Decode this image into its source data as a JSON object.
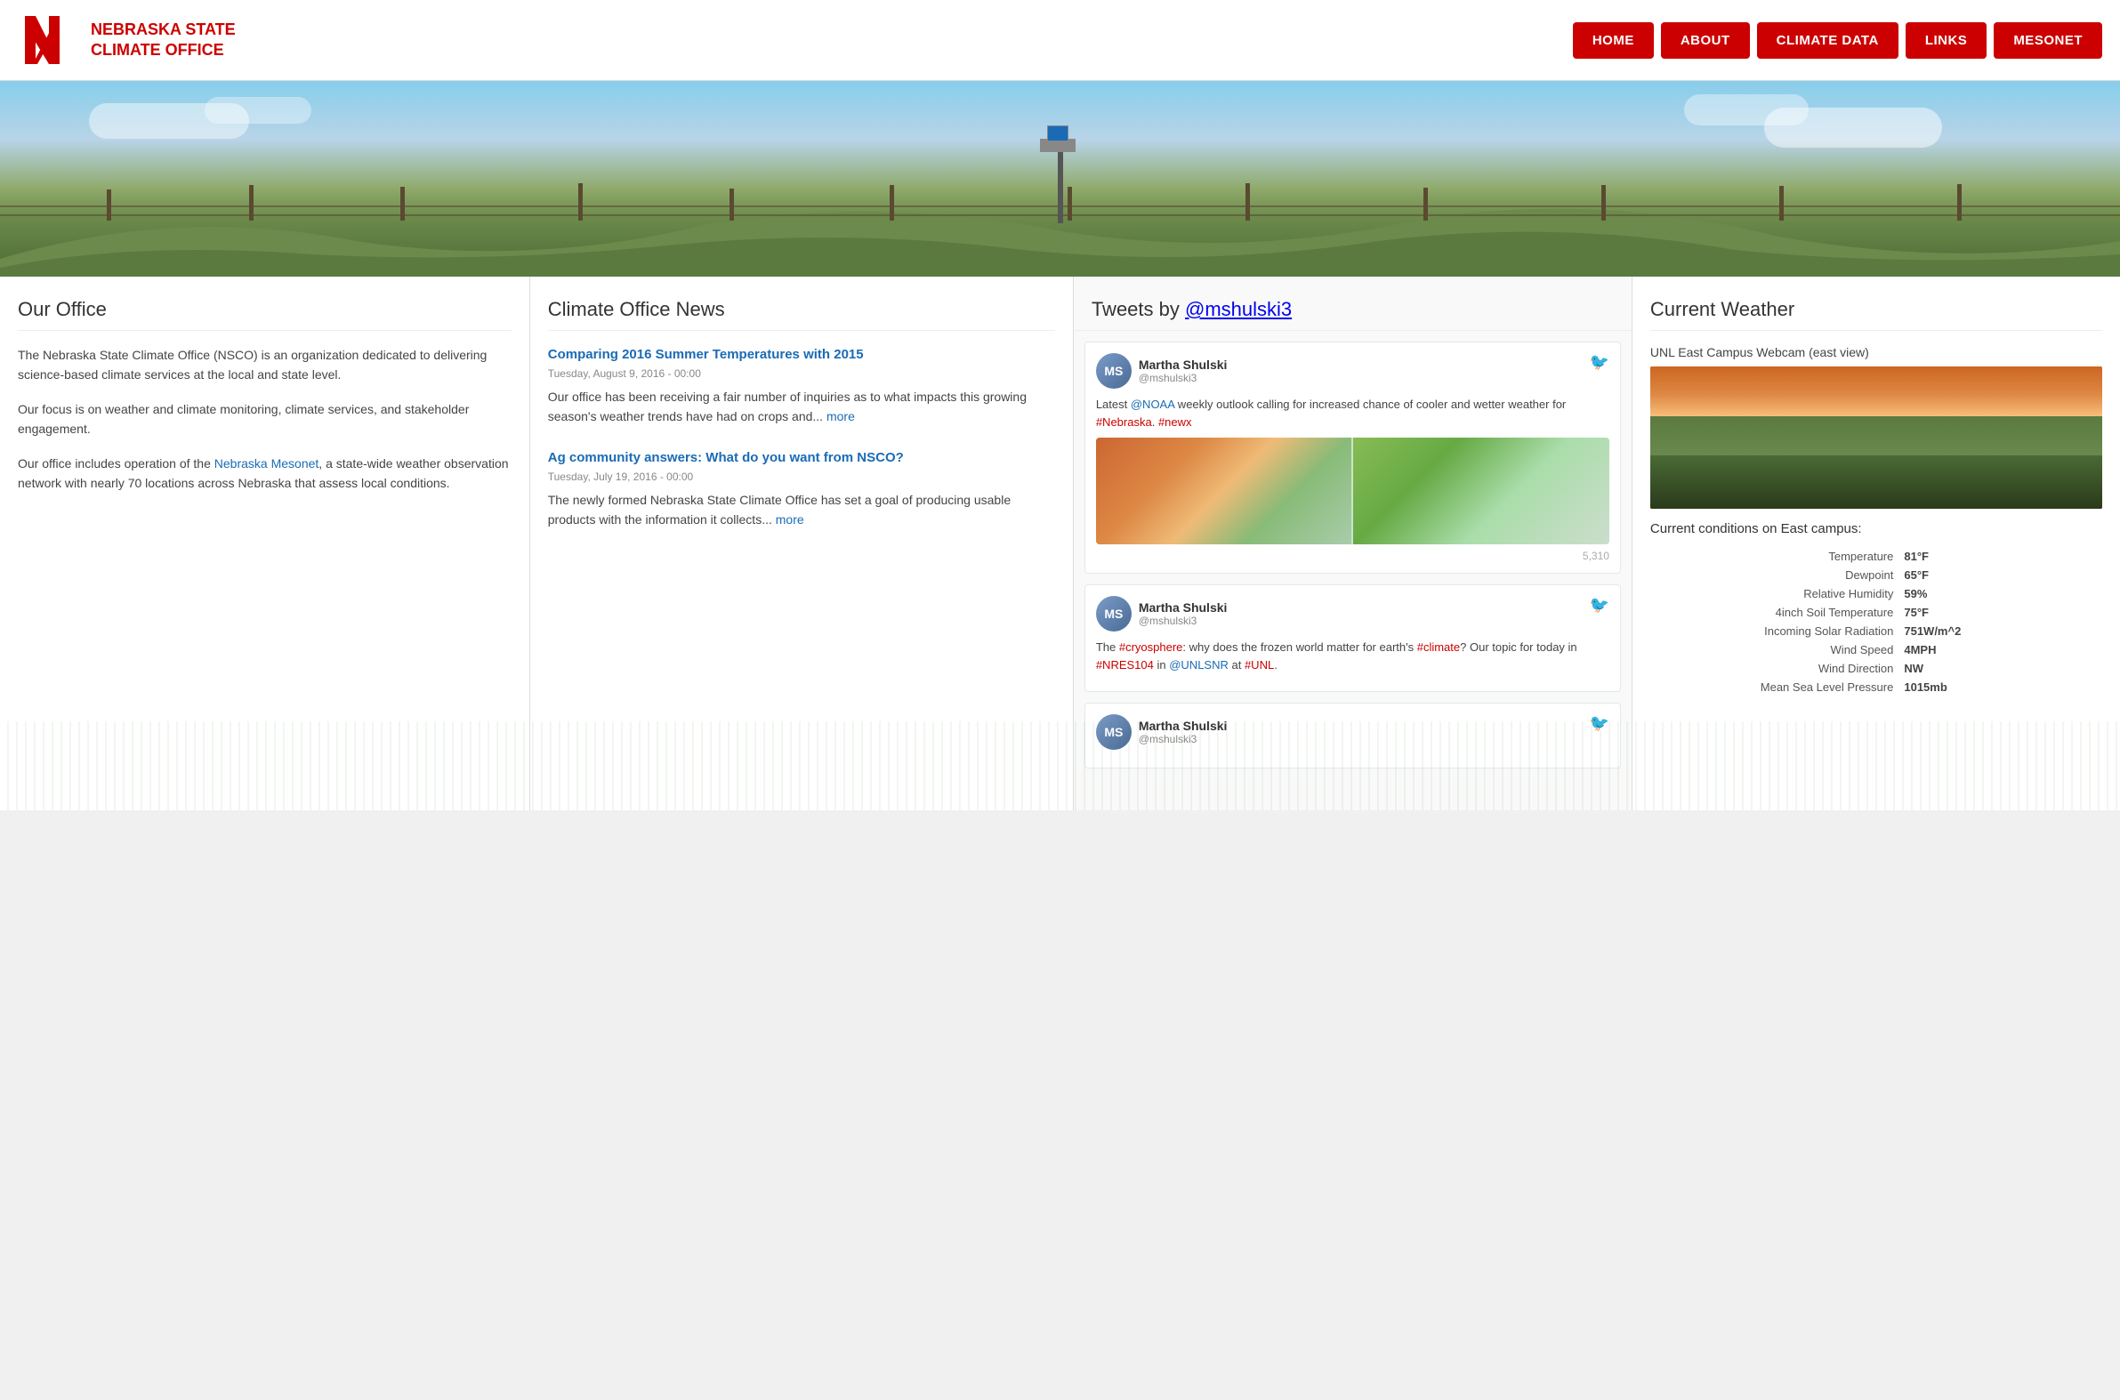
{
  "header": {
    "logo_alt": "University of Nebraska N logo",
    "site_title_line1": "NEBRASKA STATE",
    "site_title_line2": "CLIMATE OFFICE",
    "nav": [
      {
        "label": "HOME",
        "id": "home"
      },
      {
        "label": "ABOUT",
        "id": "about"
      },
      {
        "label": "CLIMATE DATA",
        "id": "climate-data"
      },
      {
        "label": "LINKS",
        "id": "links"
      },
      {
        "label": "MESONET",
        "id": "mesonet"
      }
    ]
  },
  "hero": {
    "alt": "Nebraska landscape with weather station"
  },
  "our_office": {
    "heading": "Our Office",
    "paragraphs": [
      "The Nebraska State Climate Office (NSCO) is an organization dedicated to delivering science-based climate services at the local and state level.",
      "Our focus is on weather and climate monitoring, climate services, and stakeholder engagement.",
      "Our office includes operation of the Nebraska Mesonet, a state-wide weather observation network with nearly 70 locations across Nebraska that assess local conditions."
    ],
    "mesonet_link_text": "Nebraska Mesonet"
  },
  "news": {
    "heading": "Climate Office News",
    "items": [
      {
        "title": "Comparing 2016 Summer Temperatures with 2015",
        "date": "Tuesday, August 9, 2016 - 00:00",
        "excerpt": "Our office has been receiving a fair number of inquiries as to what impacts this growing season's weather trends have had on crops and...",
        "more_link": "more"
      },
      {
        "title": "Ag community answers: What do you want from NSCO?",
        "date": "Tuesday, July 19, 2016 - 00:00",
        "excerpt": "The newly formed Nebraska State Climate Office has set a goal of producing usable products with the information it collects...",
        "more_link": "more"
      }
    ]
  },
  "tweets": {
    "heading": "Tweets",
    "by_label": "by",
    "handle": "@mshulski3",
    "items": [
      {
        "user_name": "Martha Shulski",
        "user_handle": "@mshulski3",
        "text_parts": [
          {
            "type": "text",
            "content": "Latest "
          },
          {
            "type": "mention",
            "content": "@NOAA"
          },
          {
            "type": "text",
            "content": " weekly outlook calling for increased chance of cooler and wetter weather for "
          },
          {
            "type": "hashtag",
            "content": "#Nebraska"
          },
          {
            "type": "text",
            "content": ". "
          },
          {
            "type": "hashtag",
            "content": "#newx"
          }
        ],
        "text": "Latest @NOAA weekly outlook calling for increased chance of cooler and wetter weather for #Nebraska. #newx",
        "has_image": true,
        "stats": "5,310"
      },
      {
        "user_name": "Martha Shulski",
        "user_handle": "@mshulski3",
        "text": "The #cryosphere: why does the frozen world matter for earth's #climate? Our topic for today in #NRES104 in @UNLSNR at #UNL.",
        "has_image": false,
        "stats": ""
      },
      {
        "user_name": "Martha Shulski",
        "user_handle": "@mshulski3",
        "text": "",
        "has_image": false,
        "stats": ""
      }
    ]
  },
  "current_weather": {
    "heading": "Current Weather",
    "webcam_label": "UNL East Campus Webcam (east view)",
    "conditions_label": "Current conditions on East campus:",
    "fields": [
      {
        "label": "Temperature",
        "value": "81°F"
      },
      {
        "label": "Dewpoint",
        "value": "65°F"
      },
      {
        "label": "Relative Humidity",
        "value": "59%"
      },
      {
        "label": "4inch Soil Temperature",
        "value": "75°F"
      },
      {
        "label": "Incoming Solar Radiation",
        "value": "751W/m^2"
      },
      {
        "label": "Wind Speed",
        "value": "4MPH"
      },
      {
        "label": "Wind Direction",
        "value": "NW"
      },
      {
        "label": "Mean Sea Level Pressure",
        "value": "1015mb"
      }
    ]
  }
}
